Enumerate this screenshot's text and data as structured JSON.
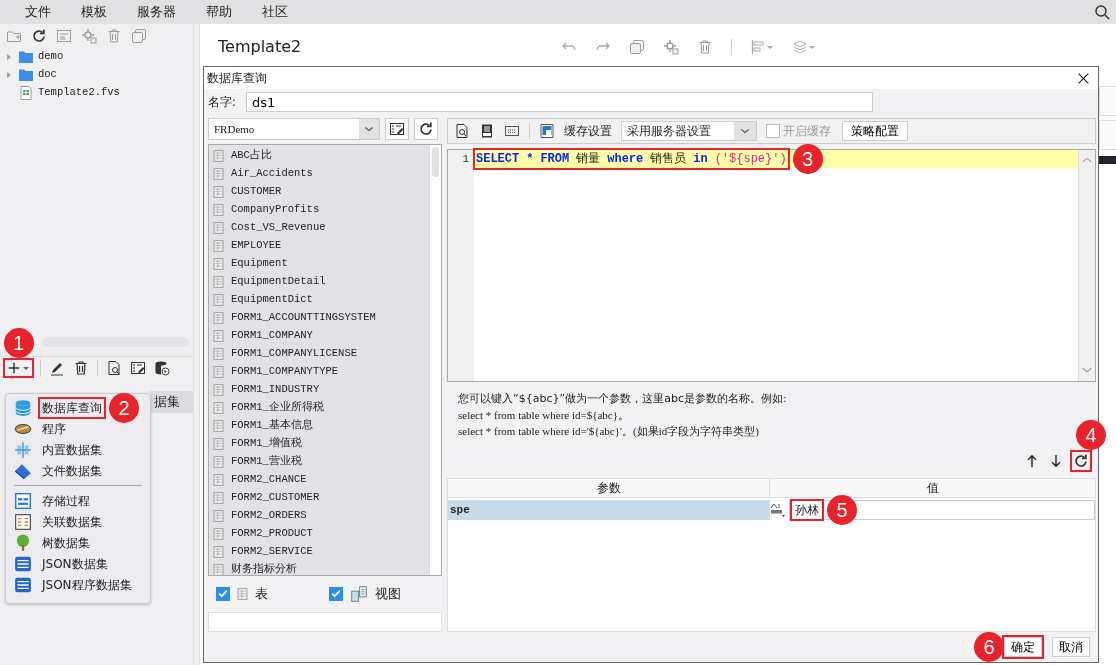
{
  "menu_bar": {
    "items": [
      "文件",
      "模板",
      "服务器",
      "帮助",
      "社区"
    ]
  },
  "file_tree": {
    "items": [
      {
        "label": "demo",
        "kind": "folder"
      },
      {
        "label": "doc",
        "kind": "folder"
      },
      {
        "label": "Template2.fvs",
        "kind": "file"
      }
    ]
  },
  "dataset_toolbar": {
    "add_outlined": true,
    "add_callout": "1"
  },
  "dataset_list": {
    "items": [
      {
        "label": "据集",
        "selected": true
      }
    ]
  },
  "new_dataset_menu": {
    "groups": [
      [
        {
          "label": "数据库查询",
          "outlined": true,
          "callout": "2"
        },
        {
          "label": "程序",
          "outlined": false
        },
        {
          "label": "内置数据集",
          "outlined": false
        },
        {
          "label": "文件数据集",
          "outlined": false
        }
      ],
      [
        {
          "label": "存储过程",
          "outlined": false
        },
        {
          "label": "关联数据集",
          "outlined": false
        },
        {
          "label": "树数据集",
          "outlined": false
        },
        {
          "label": "JSON数据集",
          "outlined": false
        },
        {
          "label": "JSON程序数据集",
          "outlined": false
        }
      ]
    ]
  },
  "editor": {
    "title": "Template2"
  },
  "dialog": {
    "title": "数据库查询",
    "name_label": "名字:",
    "name_value": "ds1",
    "connection": "FRDemo",
    "tables": [
      "ABC占比",
      "Air_Accidents",
      "CUSTOMER",
      "CompanyProfits",
      "Cost_VS_Revenue",
      "EMPLOYEE",
      "Equipment",
      "EquipmentDetail",
      "EquipmentDict",
      "FORM1_ACCOUNTTINGSYSTEM",
      "FORM1_COMPANY",
      "FORM1_COMPANYLICENSE",
      "FORM1_COMPANYTYPE",
      "FORM1_INDUSTRY",
      "FORM1_企业所得税",
      "FORM1_基本信息",
      "FORM1_增值税",
      "FORM1_营业税",
      "FORM2_CHANCE",
      "FORM2_CUSTOMER",
      "FORM2_ORDERS",
      "FORM2_PRODUCT",
      "FORM2_SERVICE",
      "财务指标分析"
    ],
    "filters": [
      {
        "label": "表",
        "kind": "table",
        "checked": true
      },
      {
        "label": "视图",
        "kind": "view",
        "checked": true
      }
    ],
    "cache_label": "缓存设置",
    "cache_mode": "采用服务器设置",
    "cache_enabled": {
      "label": "开启缓存",
      "checked": false,
      "disabled": true
    },
    "strategy_button": "策略配置",
    "sql": {
      "line_number": "1",
      "outlined": true,
      "callout": "3",
      "tokens": [
        {
          "text": "SELECT",
          "kind": "keyword"
        },
        {
          "text": "*",
          "kind": "keyword"
        },
        {
          "text": "FROM",
          "kind": "keyword"
        },
        {
          "text": "销量",
          "kind": "name"
        },
        {
          "text": "where",
          "kind": "keyword"
        },
        {
          "text": "销售员",
          "kind": "name"
        },
        {
          "text": "in",
          "kind": "keyword"
        },
        {
          "text": "('${spe}')",
          "kind": "string"
        }
      ]
    },
    "hint_lines": [
      "您可以键入“${abc}”做为一个参数，这里abc是参数的名称。例如:",
      "select * from table where id=${abc}。",
      "select * from table where id='${abc}'。(如果id字段为字符串类型)"
    ],
    "refresh_outlined": true,
    "refresh_callout": "4",
    "params": {
      "columns": [
        "参数",
        "值"
      ],
      "rows": [
        {
          "name": "spe",
          "value": "孙林",
          "selected": true,
          "value_outlined": true,
          "callout": "5"
        }
      ]
    },
    "buttons": [
      {
        "label": "确定",
        "outlined": true,
        "callout": "6"
      },
      {
        "label": "取消",
        "outlined": false
      }
    ]
  }
}
